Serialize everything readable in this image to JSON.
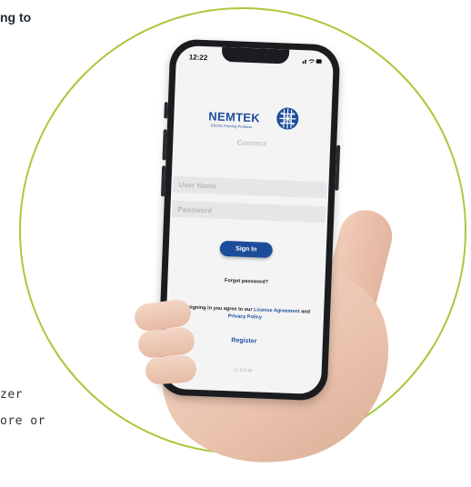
{
  "page": {
    "heading_fragment": "ng to",
    "body_fragment_lines": [
      "zer",
      "ore or"
    ]
  },
  "status_bar": {
    "time": "12:22",
    "icons": [
      "signal-icon",
      "wifi-icon",
      "battery-icon"
    ]
  },
  "logo": {
    "brand": "NEMTEK",
    "tagline": "Electric Fencing Products"
  },
  "app": {
    "name": "Connect"
  },
  "form": {
    "username_placeholder": "User Name",
    "password_placeholder": "Password",
    "signin_label": "Sign In",
    "forgot_password": "Forgot password?",
    "agreement_prefix": "By signing in you agree to our",
    "license_link": "License Agreement",
    "and_text": "and",
    "privacy_link": "Privacy Policy",
    "register_label": "Register",
    "version": "v1.5.0.40"
  },
  "colors": {
    "brand_blue": "#1c4d9a",
    "circle_green": "#a8c93a"
  }
}
